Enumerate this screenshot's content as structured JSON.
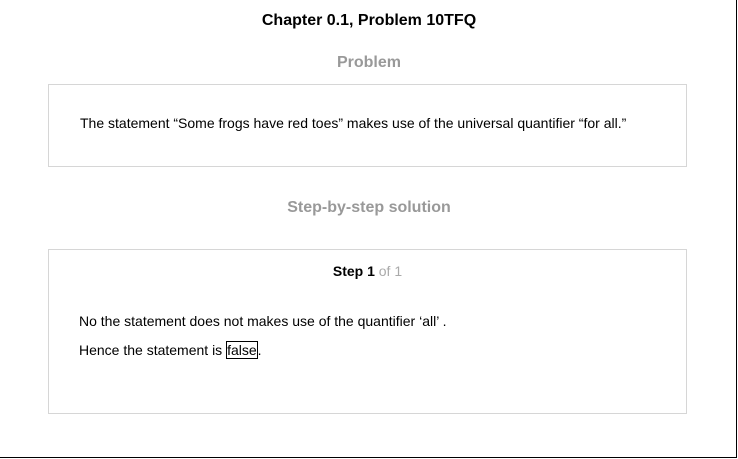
{
  "title": "Chapter 0.1, Problem 10TFQ",
  "problem": {
    "heading": "Problem",
    "text": "The statement “Some frogs have red toes” makes use of the universal quantifier “for all.”"
  },
  "solution": {
    "heading": "Step-by-step solution",
    "step": {
      "label": "Step 1",
      "of": "of 1",
      "line1": "No the statement does not makes use of the quantifier ‘all’ .",
      "line2_prefix": "Hence the statement is ",
      "answer": "false",
      "line2_suffix": "."
    }
  }
}
